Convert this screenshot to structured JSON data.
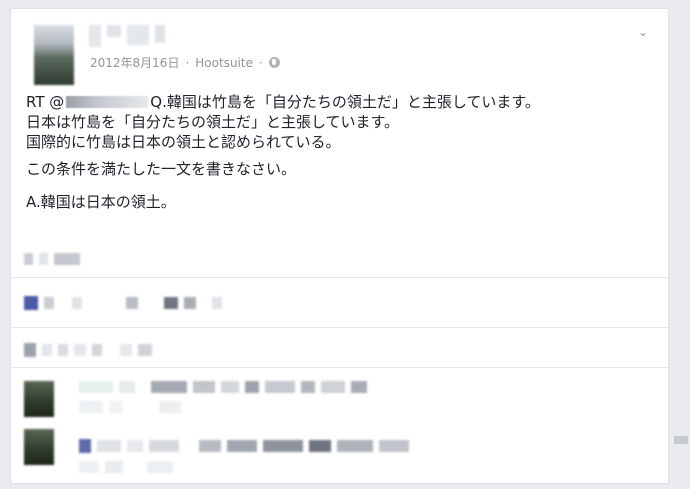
{
  "post": {
    "date": "2012年8月16日",
    "separator": "·",
    "source": "Hootsuite",
    "rt_prefix": "RT @",
    "line1_rest": "Q.韓国は竹島を「自分たちの領土だ」と主張しています。",
    "line2": "日本は竹島を「自分たちの領土だ」と主張しています。",
    "line3": "国際的に竹島は日本の領土と認められている。",
    "line4": "この条件を満たした一文を書きなさい。",
    "line5": "A.韓国は日本の領土。"
  },
  "icons": {
    "privacy": "globe-icon",
    "menu": "chevron-down-icon"
  },
  "colors": {
    "meta_text": "#90949c",
    "body_text": "#1d2129",
    "background": "#e9ebee",
    "card": "#ffffff"
  }
}
